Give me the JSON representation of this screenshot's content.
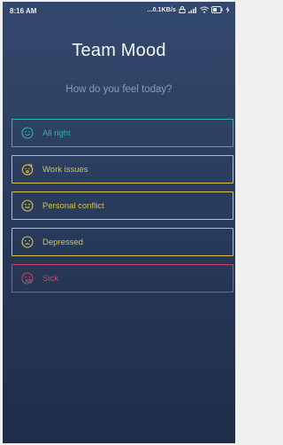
{
  "status_bar": {
    "time": "8:16 AM",
    "network_speed": "...0.1KB/s"
  },
  "app": {
    "title": "Team Mood",
    "subtitle": "How do you feel today?"
  },
  "moods": [
    {
      "label": "All right",
      "icon": "smile-icon",
      "color": "#2fb3a5"
    },
    {
      "label": "Work issues",
      "icon": "exploding-face-icon",
      "color": "#d8c24a"
    },
    {
      "label": "Personal conflict",
      "icon": "confused-face-icon",
      "color": "#d8c24a"
    },
    {
      "label": "Depressed",
      "icon": "sad-face-icon",
      "color": "#d8c24a"
    },
    {
      "label": "Sick",
      "icon": "sick-face-icon",
      "color": "#c9456a"
    }
  ]
}
